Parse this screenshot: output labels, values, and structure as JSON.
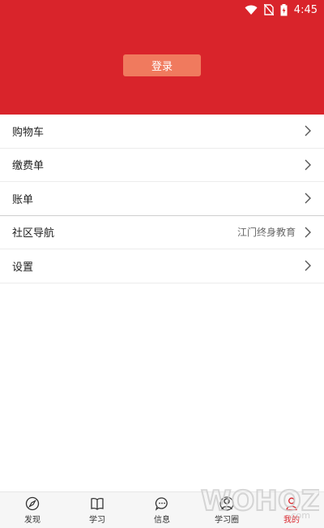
{
  "status_bar": {
    "time": "4:45",
    "icons": [
      "wifi-icon",
      "no-sim-icon",
      "battery-charging-icon"
    ]
  },
  "header": {
    "login_label": "登录",
    "background": "#d9242b",
    "button_color": "#f07a5e"
  },
  "menu": {
    "items": [
      {
        "label": "购物车",
        "value": ""
      },
      {
        "label": "缴费单",
        "value": ""
      },
      {
        "label": "账单",
        "value": ""
      },
      {
        "label": "社区导航",
        "value": "江门终身教育"
      },
      {
        "label": "设置",
        "value": ""
      }
    ]
  },
  "tabbar": {
    "items": [
      {
        "label": "发现",
        "icon": "compass-icon"
      },
      {
        "label": "学习",
        "icon": "book-icon"
      },
      {
        "label": "信息",
        "icon": "chat-icon"
      },
      {
        "label": "学习圈",
        "icon": "group-icon"
      },
      {
        "label": "我的",
        "icon": "person-icon",
        "active": true
      }
    ],
    "active_color": "#d9242b"
  },
  "watermark": {
    "text": "WOHOZ",
    "suffix": ".com"
  }
}
